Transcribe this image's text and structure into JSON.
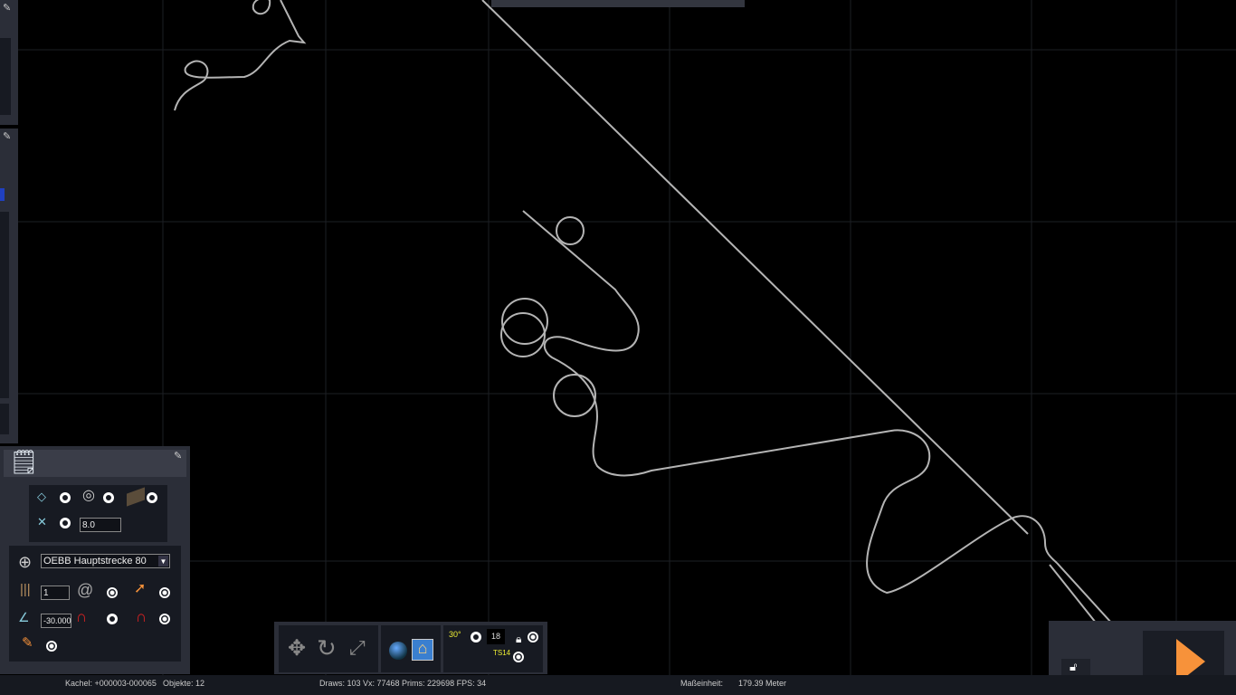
{
  "top_left_panel": {
    "pin_icon": "pin-icon"
  },
  "track_panel": {
    "width_value": "8.0",
    "track_rule": "OEBB Hauptstrecke 80",
    "track_count": "1",
    "slope_value": "-30.000"
  },
  "toolbar": {
    "grid_number": "18",
    "angle_label": "30°",
    "ts_label": "TS14"
  },
  "status_bar": {
    "tile": "Kachel: +000003-000065",
    "objects": "Objekte: 12",
    "stats": "Draws: 103 Vx: 77468 Prims: 229698 FPS: 34",
    "unit_label": "Maßeinheit:",
    "unit_value": "179.39 Meter"
  },
  "colors": {
    "accent": "#f7923a",
    "track": "#b4b4b4",
    "panel": "#2b2e38"
  }
}
